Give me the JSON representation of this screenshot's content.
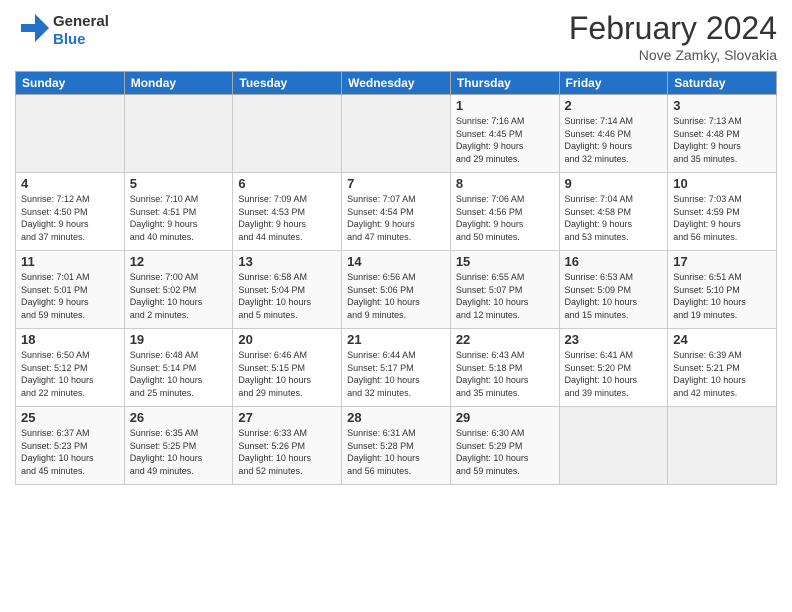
{
  "logo": {
    "general": "General",
    "blue": "Blue"
  },
  "header": {
    "month": "February 2024",
    "location": "Nove Zamky, Slovakia"
  },
  "days_of_week": [
    "Sunday",
    "Monday",
    "Tuesday",
    "Wednesday",
    "Thursday",
    "Friday",
    "Saturday"
  ],
  "weeks": [
    [
      {
        "day": "",
        "info": ""
      },
      {
        "day": "",
        "info": ""
      },
      {
        "day": "",
        "info": ""
      },
      {
        "day": "",
        "info": ""
      },
      {
        "day": "1",
        "info": "Sunrise: 7:16 AM\nSunset: 4:45 PM\nDaylight: 9 hours\nand 29 minutes."
      },
      {
        "day": "2",
        "info": "Sunrise: 7:14 AM\nSunset: 4:46 PM\nDaylight: 9 hours\nand 32 minutes."
      },
      {
        "day": "3",
        "info": "Sunrise: 7:13 AM\nSunset: 4:48 PM\nDaylight: 9 hours\nand 35 minutes."
      }
    ],
    [
      {
        "day": "4",
        "info": "Sunrise: 7:12 AM\nSunset: 4:50 PM\nDaylight: 9 hours\nand 37 minutes."
      },
      {
        "day": "5",
        "info": "Sunrise: 7:10 AM\nSunset: 4:51 PM\nDaylight: 9 hours\nand 40 minutes."
      },
      {
        "day": "6",
        "info": "Sunrise: 7:09 AM\nSunset: 4:53 PM\nDaylight: 9 hours\nand 44 minutes."
      },
      {
        "day": "7",
        "info": "Sunrise: 7:07 AM\nSunset: 4:54 PM\nDaylight: 9 hours\nand 47 minutes."
      },
      {
        "day": "8",
        "info": "Sunrise: 7:06 AM\nSunset: 4:56 PM\nDaylight: 9 hours\nand 50 minutes."
      },
      {
        "day": "9",
        "info": "Sunrise: 7:04 AM\nSunset: 4:58 PM\nDaylight: 9 hours\nand 53 minutes."
      },
      {
        "day": "10",
        "info": "Sunrise: 7:03 AM\nSunset: 4:59 PM\nDaylight: 9 hours\nand 56 minutes."
      }
    ],
    [
      {
        "day": "11",
        "info": "Sunrise: 7:01 AM\nSunset: 5:01 PM\nDaylight: 9 hours\nand 59 minutes."
      },
      {
        "day": "12",
        "info": "Sunrise: 7:00 AM\nSunset: 5:02 PM\nDaylight: 10 hours\nand 2 minutes."
      },
      {
        "day": "13",
        "info": "Sunrise: 6:58 AM\nSunset: 5:04 PM\nDaylight: 10 hours\nand 5 minutes."
      },
      {
        "day": "14",
        "info": "Sunrise: 6:56 AM\nSunset: 5:06 PM\nDaylight: 10 hours\nand 9 minutes."
      },
      {
        "day": "15",
        "info": "Sunrise: 6:55 AM\nSunset: 5:07 PM\nDaylight: 10 hours\nand 12 minutes."
      },
      {
        "day": "16",
        "info": "Sunrise: 6:53 AM\nSunset: 5:09 PM\nDaylight: 10 hours\nand 15 minutes."
      },
      {
        "day": "17",
        "info": "Sunrise: 6:51 AM\nSunset: 5:10 PM\nDaylight: 10 hours\nand 19 minutes."
      }
    ],
    [
      {
        "day": "18",
        "info": "Sunrise: 6:50 AM\nSunset: 5:12 PM\nDaylight: 10 hours\nand 22 minutes."
      },
      {
        "day": "19",
        "info": "Sunrise: 6:48 AM\nSunset: 5:14 PM\nDaylight: 10 hours\nand 25 minutes."
      },
      {
        "day": "20",
        "info": "Sunrise: 6:46 AM\nSunset: 5:15 PM\nDaylight: 10 hours\nand 29 minutes."
      },
      {
        "day": "21",
        "info": "Sunrise: 6:44 AM\nSunset: 5:17 PM\nDaylight: 10 hours\nand 32 minutes."
      },
      {
        "day": "22",
        "info": "Sunrise: 6:43 AM\nSunset: 5:18 PM\nDaylight: 10 hours\nand 35 minutes."
      },
      {
        "day": "23",
        "info": "Sunrise: 6:41 AM\nSunset: 5:20 PM\nDaylight: 10 hours\nand 39 minutes."
      },
      {
        "day": "24",
        "info": "Sunrise: 6:39 AM\nSunset: 5:21 PM\nDaylight: 10 hours\nand 42 minutes."
      }
    ],
    [
      {
        "day": "25",
        "info": "Sunrise: 6:37 AM\nSunset: 5:23 PM\nDaylight: 10 hours\nand 45 minutes."
      },
      {
        "day": "26",
        "info": "Sunrise: 6:35 AM\nSunset: 5:25 PM\nDaylight: 10 hours\nand 49 minutes."
      },
      {
        "day": "27",
        "info": "Sunrise: 6:33 AM\nSunset: 5:26 PM\nDaylight: 10 hours\nand 52 minutes."
      },
      {
        "day": "28",
        "info": "Sunrise: 6:31 AM\nSunset: 5:28 PM\nDaylight: 10 hours\nand 56 minutes."
      },
      {
        "day": "29",
        "info": "Sunrise: 6:30 AM\nSunset: 5:29 PM\nDaylight: 10 hours\nand 59 minutes."
      },
      {
        "day": "",
        "info": ""
      },
      {
        "day": "",
        "info": ""
      }
    ]
  ]
}
